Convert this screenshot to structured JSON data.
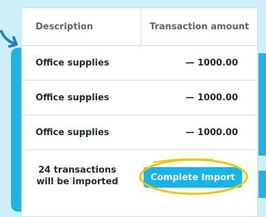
{
  "table": {
    "headers": {
      "description": "Description",
      "amount": "Transaction amount"
    },
    "rows": [
      {
        "description": "Office supplies",
        "amount": "— 1000.00"
      },
      {
        "description": "Office supplies",
        "amount": "— 1000.00"
      },
      {
        "description": "Office supplies",
        "amount": "— 1000.00"
      }
    ]
  },
  "footer": {
    "summary_line1": "24 transactions",
    "summary_line2": "will be imported",
    "button_label": "Complete Import"
  },
  "colors": {
    "accent": "#13b5ea",
    "background": "#cdeff9",
    "highlight": "#f5c400"
  },
  "icons": {
    "arrow": "curved-arrow-icon"
  }
}
